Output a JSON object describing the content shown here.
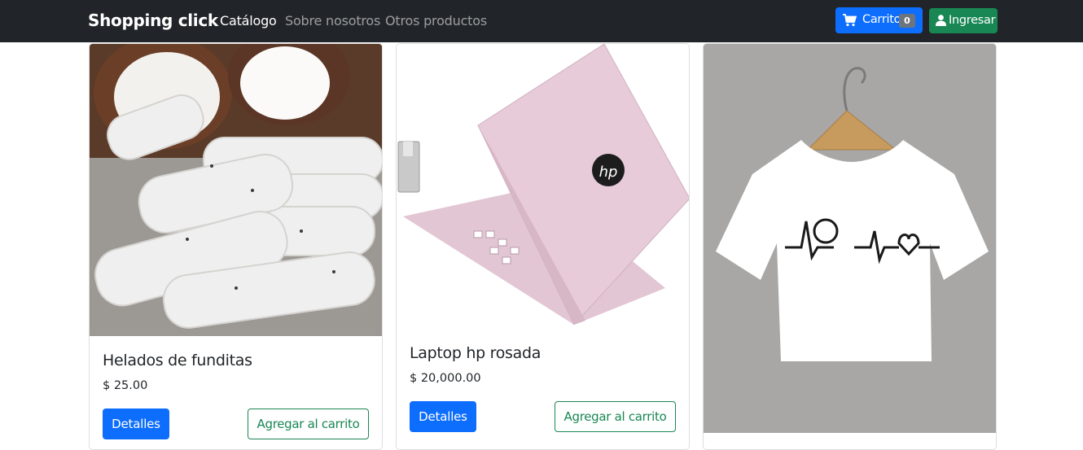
{
  "navbar": {
    "brand": "Shopping click",
    "links": [
      "Catálogo",
      "Sobre nosotros",
      "Otros productos"
    ],
    "cart_label": "Carrito",
    "cart_count": "0",
    "login_label": "Ingresar"
  },
  "products": [
    {
      "name": "Helados de funditas",
      "price": "$ 25.00",
      "details_label": "Detalles",
      "add_label": "Agregar al carrito"
    },
    {
      "name": "Laptop hp rosada",
      "price": "$ 20,000.00",
      "details_label": "Detalles",
      "add_label": "Agregar al carrito"
    },
    {
      "name": "",
      "price": "",
      "details_label": "",
      "add_label": ""
    }
  ],
  "colors": {
    "navbar_bg": "#212529",
    "primary": "#0d6efd",
    "success": "#198754",
    "badge": "#6c757d"
  },
  "icons": [
    "cart-icon",
    "user-icon"
  ]
}
